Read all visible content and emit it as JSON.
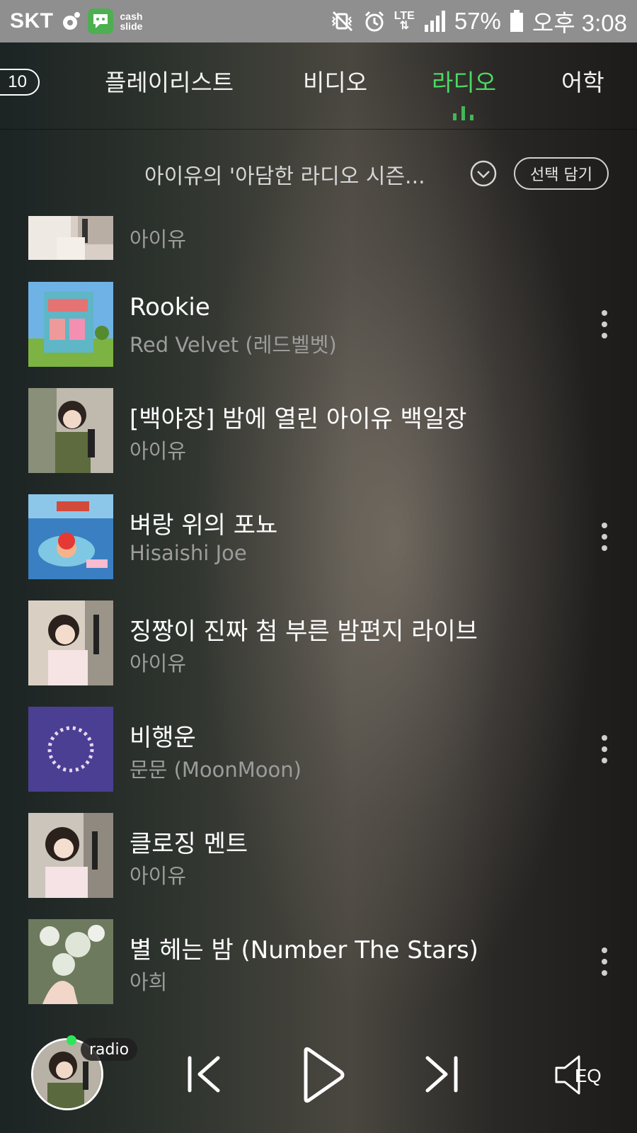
{
  "status_bar": {
    "carrier": "SKT",
    "cashslide_label": "cash\nslide",
    "network": "LTE",
    "battery": "57%",
    "time": "오후 3:08"
  },
  "tabs": {
    "count": "10",
    "items": [
      {
        "label": "플레이리스트"
      },
      {
        "label": "비디오"
      },
      {
        "label": "라디오"
      },
      {
        "label": "어학"
      }
    ],
    "active": "라디오"
  },
  "playlist": {
    "title": "아이유의 '아담한 라디오 시즌...",
    "select_button": "선택 담기"
  },
  "tracks": [
    {
      "title": "",
      "artist": "아이유"
    },
    {
      "title": "Rookie",
      "artist": "Red Velvet (레드벨벳)"
    },
    {
      "title": "[백야장] 밤에 열린 아이유 백일장",
      "artist": "아이유"
    },
    {
      "title": "벼랑 위의 포뇨",
      "artist": "Hisaishi Joe"
    },
    {
      "title": "징짱이 진짜 첨 부른 밤편지 라이브",
      "artist": "아이유"
    },
    {
      "title": "비행운",
      "artist": "문문 (MoonMoon)"
    },
    {
      "title": "클로징 멘트",
      "artist": "아이유"
    },
    {
      "title": "별 헤는 밤 (Number The Stars)",
      "artist": "아희"
    }
  ],
  "player": {
    "badge": "radio",
    "eq_label": "EQ"
  },
  "colors": {
    "accent": "#4cd964",
    "status_bar": "#8f8f8f",
    "secondary_text": "#9c9c9c"
  }
}
